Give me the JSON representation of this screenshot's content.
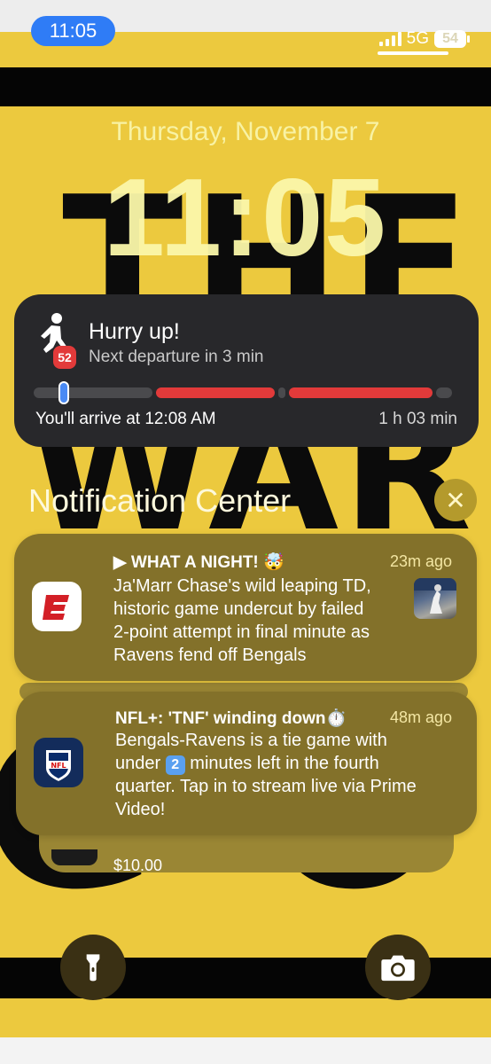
{
  "status_bar": {
    "time": "11:05",
    "network": "5G",
    "battery": "54"
  },
  "lock_screen": {
    "date": "Thursday, November 7",
    "time": "11:05",
    "wallpaper_text_top": "THE",
    "wallpaper_text_mid": "WAR",
    "wallpaper_text_bottom": "GO"
  },
  "live_activity": {
    "icon": "walking-person-icon",
    "route_badge": "52",
    "title": "Hurry up!",
    "subtitle": "Next departure in 3 min",
    "arrival": "You'll arrive at 12:08 AM",
    "duration": "1 h 03 min",
    "progress": 0.06
  },
  "notification_center": {
    "title": "Notification Center",
    "close_icon": "close-icon",
    "notifications": [
      {
        "app": "ESPN",
        "app_icon": "espn-icon",
        "title": "▶ WHAT A NIGHT! 🤯",
        "time": "23m ago",
        "body": [
          "Ja'Marr Chase's wild leaping TD,",
          "historic game undercut by failed",
          "2-point attempt in final minute as",
          "Ravens fend off Bengals"
        ]
      },
      {
        "app": "NFL",
        "app_icon": "nfl-icon",
        "title": "NFL+: 'TNF' winding down⏱️",
        "time": "48m ago",
        "body": [
          "Bengals-Ravens is a tie game with",
          "under",
          "2",
          "minutes left in the fourth",
          "quarter. Tap in to stream live via Prime",
          "Video!"
        ]
      }
    ],
    "stacked_preview": "$10.00"
  },
  "bottom_controls": {
    "flashlight_icon": "flashlight-icon",
    "camera_icon": "camera-icon"
  },
  "colors": {
    "wallpaper": "#ecc93e",
    "time_pill": "#2f7cf6",
    "route_red": "#e23a3a",
    "progress_blue": "#4a8af4"
  }
}
